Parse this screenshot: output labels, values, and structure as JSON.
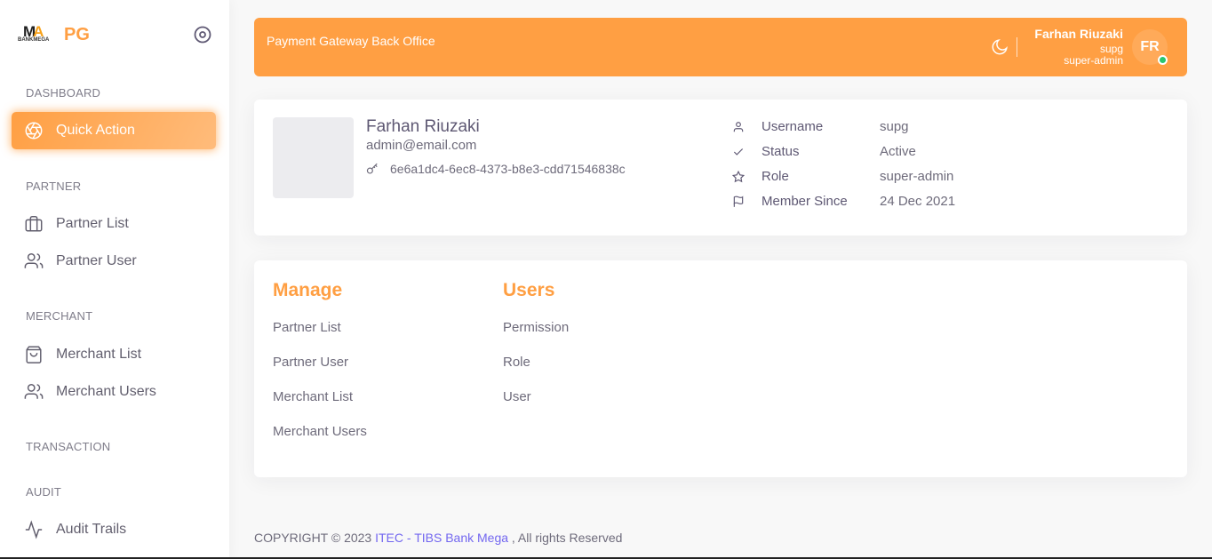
{
  "sidebar": {
    "brand_sub": "BANKMEGA",
    "brand_name": "PG",
    "sections": {
      "dashboard": "DASHBOARD",
      "partner": "PARTNER",
      "merchant": "MERCHANT",
      "transaction": "TRANSACTION",
      "audit": "AUDIT"
    },
    "items": [
      {
        "label": "Quick Action",
        "icon": "aperture-icon"
      },
      {
        "label": "Partner List",
        "icon": "briefcase-icon"
      },
      {
        "label": "Partner User",
        "icon": "users-icon"
      },
      {
        "label": "Merchant List",
        "icon": "shopping-bag-icon"
      },
      {
        "label": "Merchant Users",
        "icon": "users-icon"
      },
      {
        "label": "Audit Trails",
        "icon": "activity-icon"
      }
    ]
  },
  "header": {
    "title": "Payment Gateway Back Office",
    "user_name": "Farhan Riuzaki",
    "username": "supg",
    "role": "super-admin",
    "avatar_initials": "FR"
  },
  "profile": {
    "name": "Farhan Riuzaki",
    "email": "admin@email.com",
    "key": "6e6a1dc4-6ec8-4373-b8e3-cdd71546838c",
    "info": [
      {
        "label": "Username",
        "value": "supg",
        "icon": "user-icon"
      },
      {
        "label": "Status",
        "value": "Active",
        "icon": "check-icon"
      },
      {
        "label": "Role",
        "value": "super-admin",
        "icon": "star-icon"
      },
      {
        "label": "Member Since",
        "value": "24 Dec 2021",
        "icon": "flag-icon"
      }
    ]
  },
  "manage": {
    "title": "Manage",
    "links": [
      "Partner List",
      "Partner User",
      "Merchant List",
      "Merchant Users"
    ]
  },
  "users": {
    "title": "Users",
    "links": [
      "Permission",
      "Role",
      "User"
    ]
  },
  "footer": {
    "prefix": "COPYRIGHT © 2023 ",
    "link": "ITEC - TIBS Bank Mega",
    "suffix": " , All rights Reserved"
  },
  "colors": {
    "accent": "#ff9f43",
    "link": "#7367f0",
    "online": "#28c76f"
  }
}
